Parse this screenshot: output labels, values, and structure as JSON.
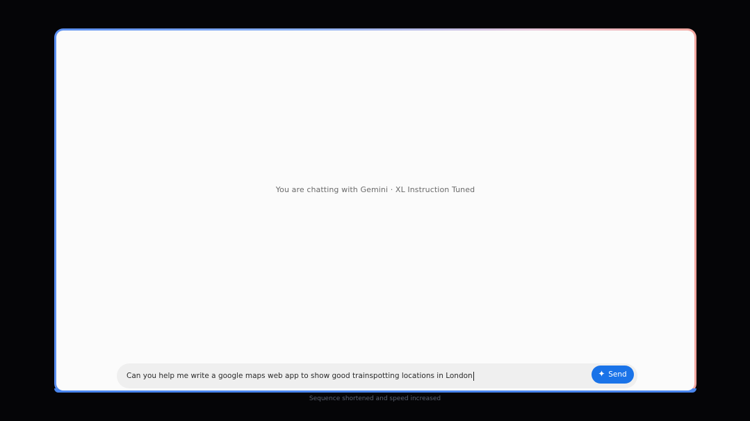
{
  "chat": {
    "status_text": "You are chatting with Gemini · XL Instruction Tuned"
  },
  "composer": {
    "input_value": "Can you help me write a google maps web app to show good trainspotting locations in London",
    "image_icon": "image-upload-icon",
    "send_label": "Send",
    "send_icon": "sparkle-icon"
  },
  "caption": {
    "text": "Sequence shortened and speed increased"
  },
  "colors": {
    "accent": "#1a73e8",
    "window_bg": "#fbfbfb",
    "page_bg": "#050507",
    "composer_bg": "#efefef"
  }
}
